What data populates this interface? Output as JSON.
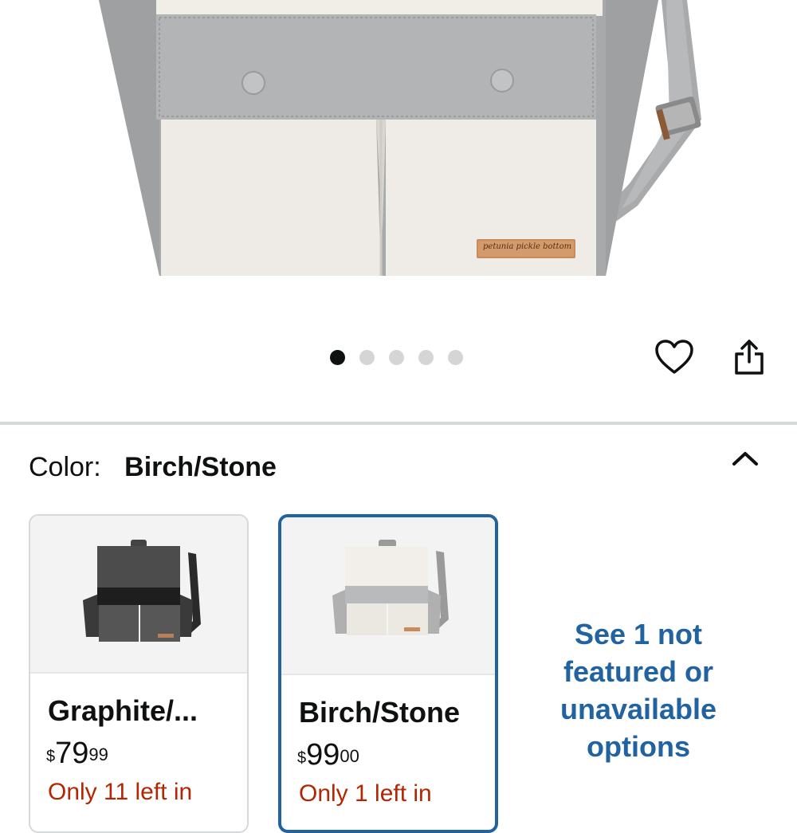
{
  "hero": {
    "brand_tag": "petunia pickle bottom"
  },
  "carousel": {
    "dots": 5,
    "active_index": 0
  },
  "actions": {
    "wishlist_icon": "heart-outline-icon",
    "share_icon": "share-icon"
  },
  "color": {
    "label": "Color:",
    "selected": "Birch/Stone",
    "collapse_icon": "chevron-up-icon"
  },
  "swatches": [
    {
      "name": "Graphite/...",
      "currency": "$",
      "price_whole": "79",
      "price_cents": "99",
      "stock": "Only 11 left in"
    },
    {
      "name": "Birch/Stone",
      "currency": "$",
      "price_whole": "99",
      "price_cents": "00",
      "stock": "Only 1 left in"
    }
  ],
  "see_more": "See 1 not featured or unavailable options",
  "colors": {
    "accent_blue": "#2162a1",
    "stock_red": "#b12704",
    "text": "#0f1111"
  }
}
